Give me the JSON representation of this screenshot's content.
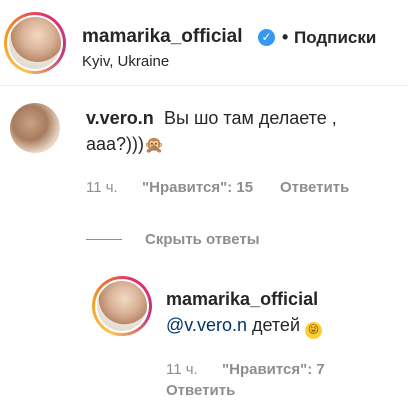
{
  "header": {
    "username": "mamarika_official",
    "verified_icon": "verified-badge-icon",
    "separator": "•",
    "follow_label": "Подписки",
    "location": "Kyiv, Ukraine"
  },
  "comment": {
    "username": "v.vero.n",
    "text_line1": "Вы шо там делаете ,",
    "text_line2": "ааа?)))",
    "emoji": "🙊",
    "time": "11 ч.",
    "likes": "\"Нравится\": 15",
    "reply_label": "Ответить"
  },
  "replies_toggle": {
    "label": "Скрыть ответы"
  },
  "reply": {
    "username": "mamarika_official",
    "mention": "@v.vero.n",
    "text": " детей ",
    "emoji": "😜",
    "time": "11 ч.",
    "likes": "\"Нравится\": 7",
    "reply_label": "Ответить"
  },
  "colors": {
    "text": "#262626",
    "muted": "#8e8e8e",
    "verified": "#3897f0",
    "mention": "#003569"
  }
}
